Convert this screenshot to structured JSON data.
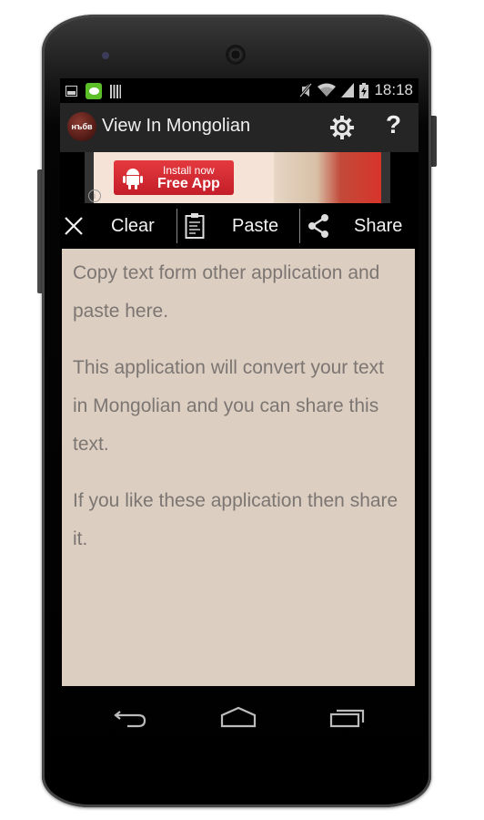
{
  "status_bar": {
    "left_icons": [
      "gallery-icon",
      "line-app-icon",
      "barcode-icon"
    ],
    "right_icons": [
      "mute-icon",
      "wifi-icon",
      "signal-icon",
      "battery-charging-icon"
    ],
    "time": "18:18"
  },
  "action_bar": {
    "logo_text": "нъбв",
    "title": "View In Mongolian",
    "settings_icon": "gear-icon",
    "help_label": "?"
  },
  "ad_banner": {
    "line1": "Install now",
    "line2": "Free App",
    "info_label": "i",
    "accent_color": "#d2232f"
  },
  "toolbar": {
    "clear_label": "Clear",
    "paste_label": "Paste",
    "share_label": "Share"
  },
  "content": {
    "paragraphs": [
      "Copy text form other application and paste here.",
      "This application will convert your text in Mongolian and you can share this text.",
      "If you like these application then share it."
    ],
    "background_color": "#ddcec2"
  },
  "nav_bar": {
    "back": "back-icon",
    "home": "home-icon",
    "recents": "recents-icon"
  }
}
